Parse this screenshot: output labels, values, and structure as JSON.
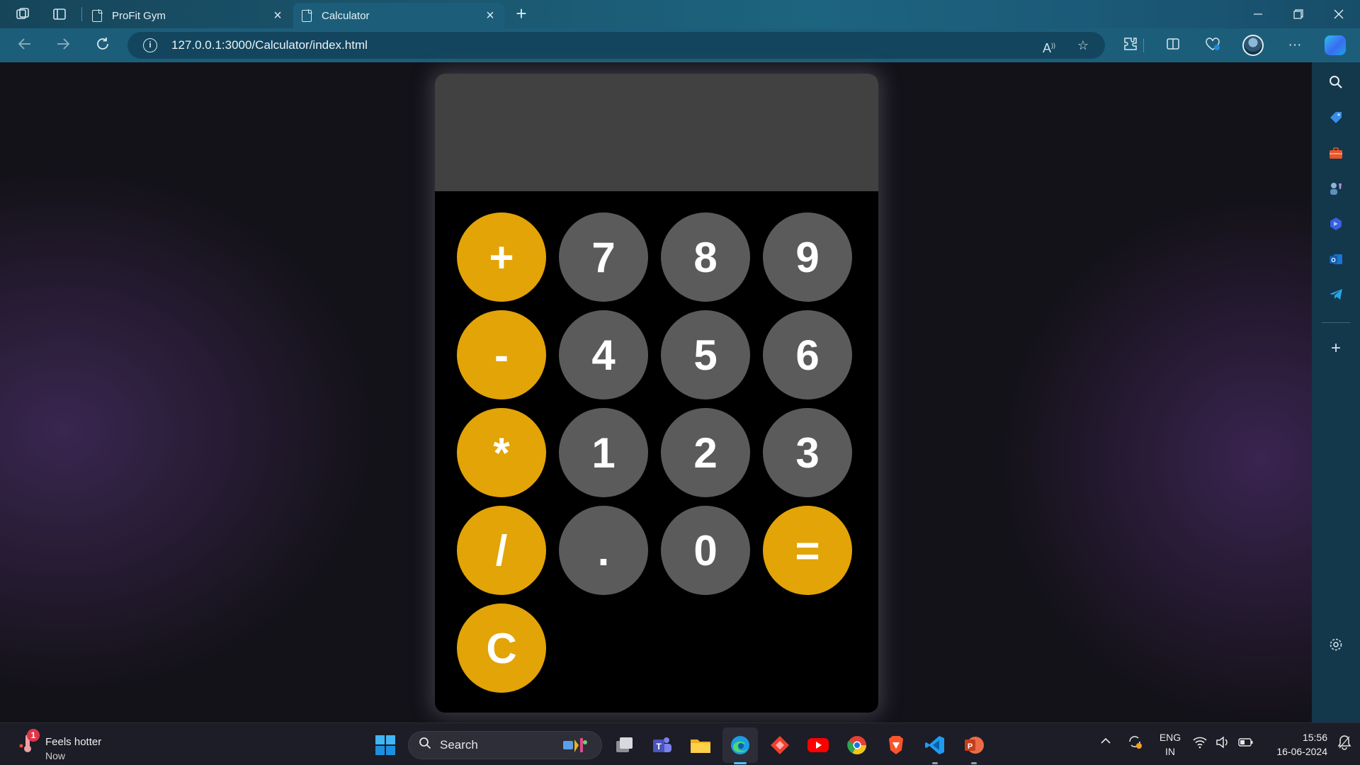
{
  "browser": {
    "tabs": [
      {
        "label": "ProFit Gym",
        "active": false
      },
      {
        "label": "Calculator",
        "active": true
      }
    ],
    "url": "127.0.0.1:3000/Calculator/index.html"
  },
  "calculator": {
    "display_value": "",
    "rows": [
      [
        "+",
        "7",
        "8",
        "9"
      ],
      [
        "-",
        "4",
        "5",
        "6"
      ],
      [
        "*",
        "1",
        "2",
        "3"
      ],
      [
        "/",
        ".",
        "0",
        "="
      ],
      [
        "C"
      ]
    ],
    "colors": {
      "operator": "#e2a407",
      "number": "#5b5b5b",
      "display": "#414141",
      "body": "#000000"
    }
  },
  "sidebar": {
    "icons": [
      "search-icon",
      "tag-icon",
      "briefcase-icon",
      "games-icon",
      "copilot-designer-icon",
      "outlook-icon",
      "telegram-icon",
      "add-icon",
      "settings-icon"
    ]
  },
  "taskbar": {
    "weather_title": "Feels hotter",
    "weather_sub": "Now",
    "weather_badge": "1",
    "search_label": "Search",
    "lang_top": "ENG",
    "lang_bottom": "IN",
    "time": "15:56",
    "date": "16-06-2024"
  }
}
